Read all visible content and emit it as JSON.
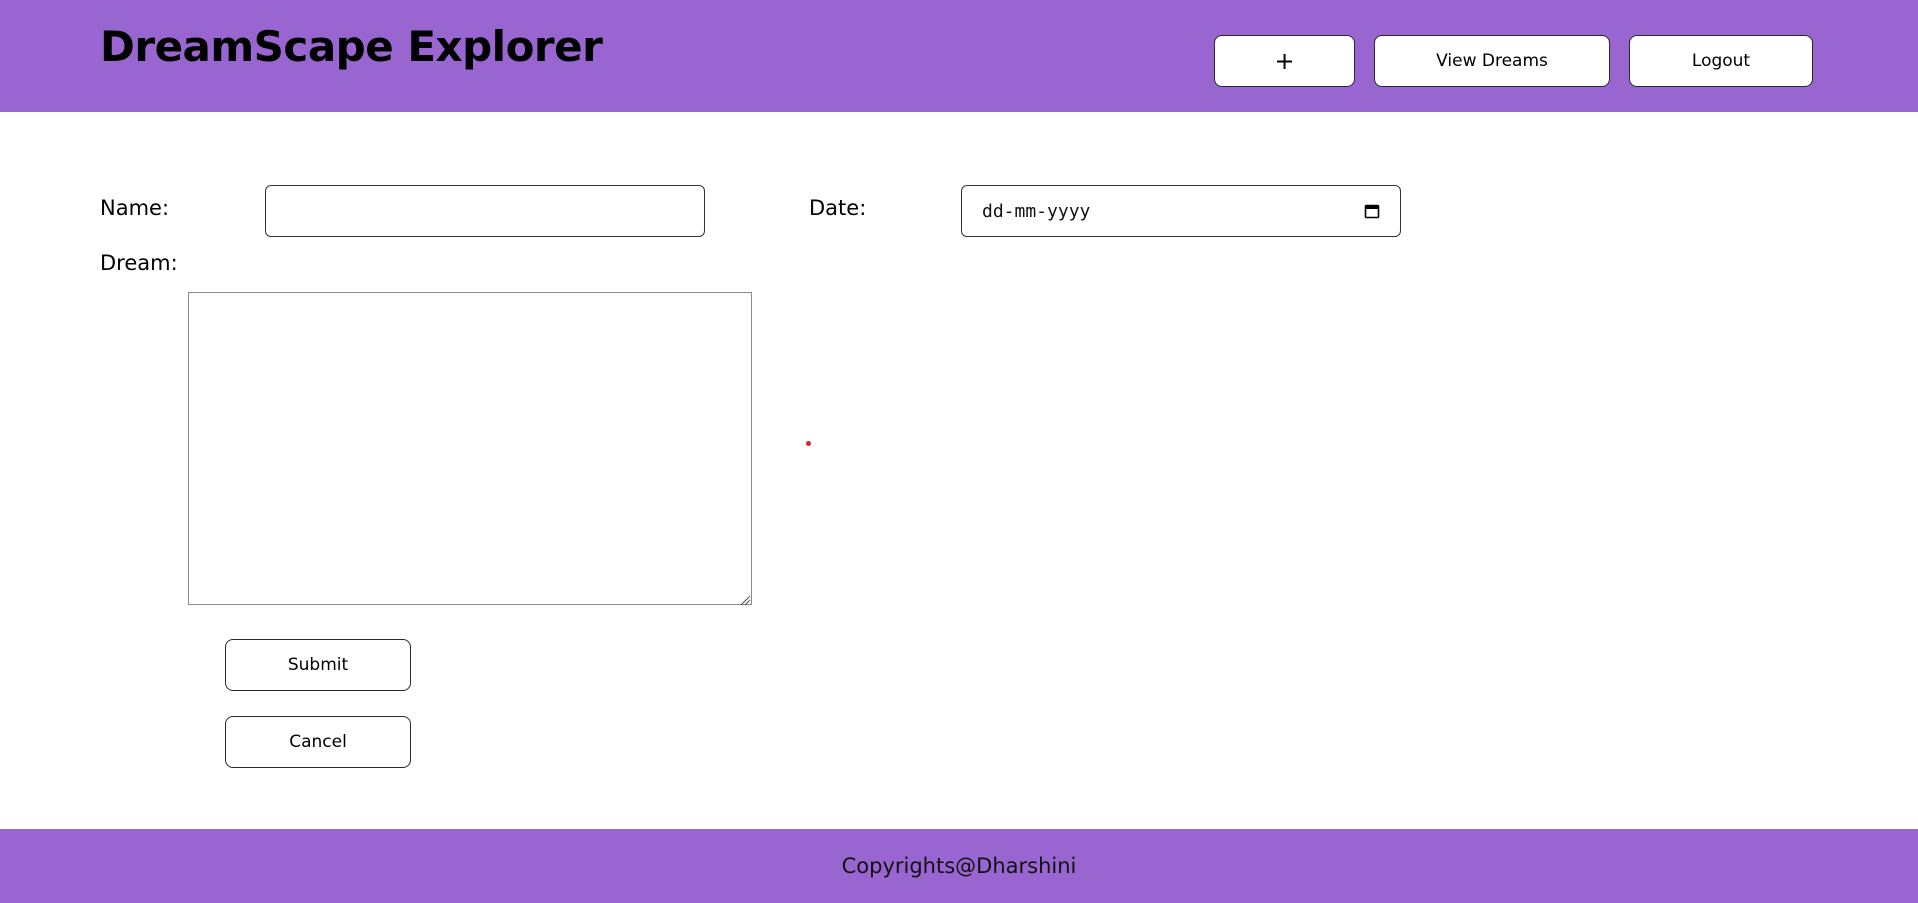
{
  "header": {
    "title": "DreamScape Explorer",
    "nav": {
      "add_label": "+",
      "view_label": "View Dreams",
      "logout_label": "Logout"
    }
  },
  "form": {
    "name_label": "Name:",
    "name_value": "",
    "date_label": "Date:",
    "date_placeholder": "dd-mm-yyyy",
    "dream_label": "Dream:",
    "dream_value": "",
    "submit_label": "Submit",
    "cancel_label": "Cancel"
  },
  "footer": {
    "text": "Copyrights@Dharshini"
  },
  "colors": {
    "brand_purple": "#9966d1",
    "button_border": "#2a2a2a",
    "cursor_dot": "#e02020"
  },
  "icons": {
    "date_picker": "calendar-icon",
    "textarea_resize": "resize-grip-icon"
  }
}
